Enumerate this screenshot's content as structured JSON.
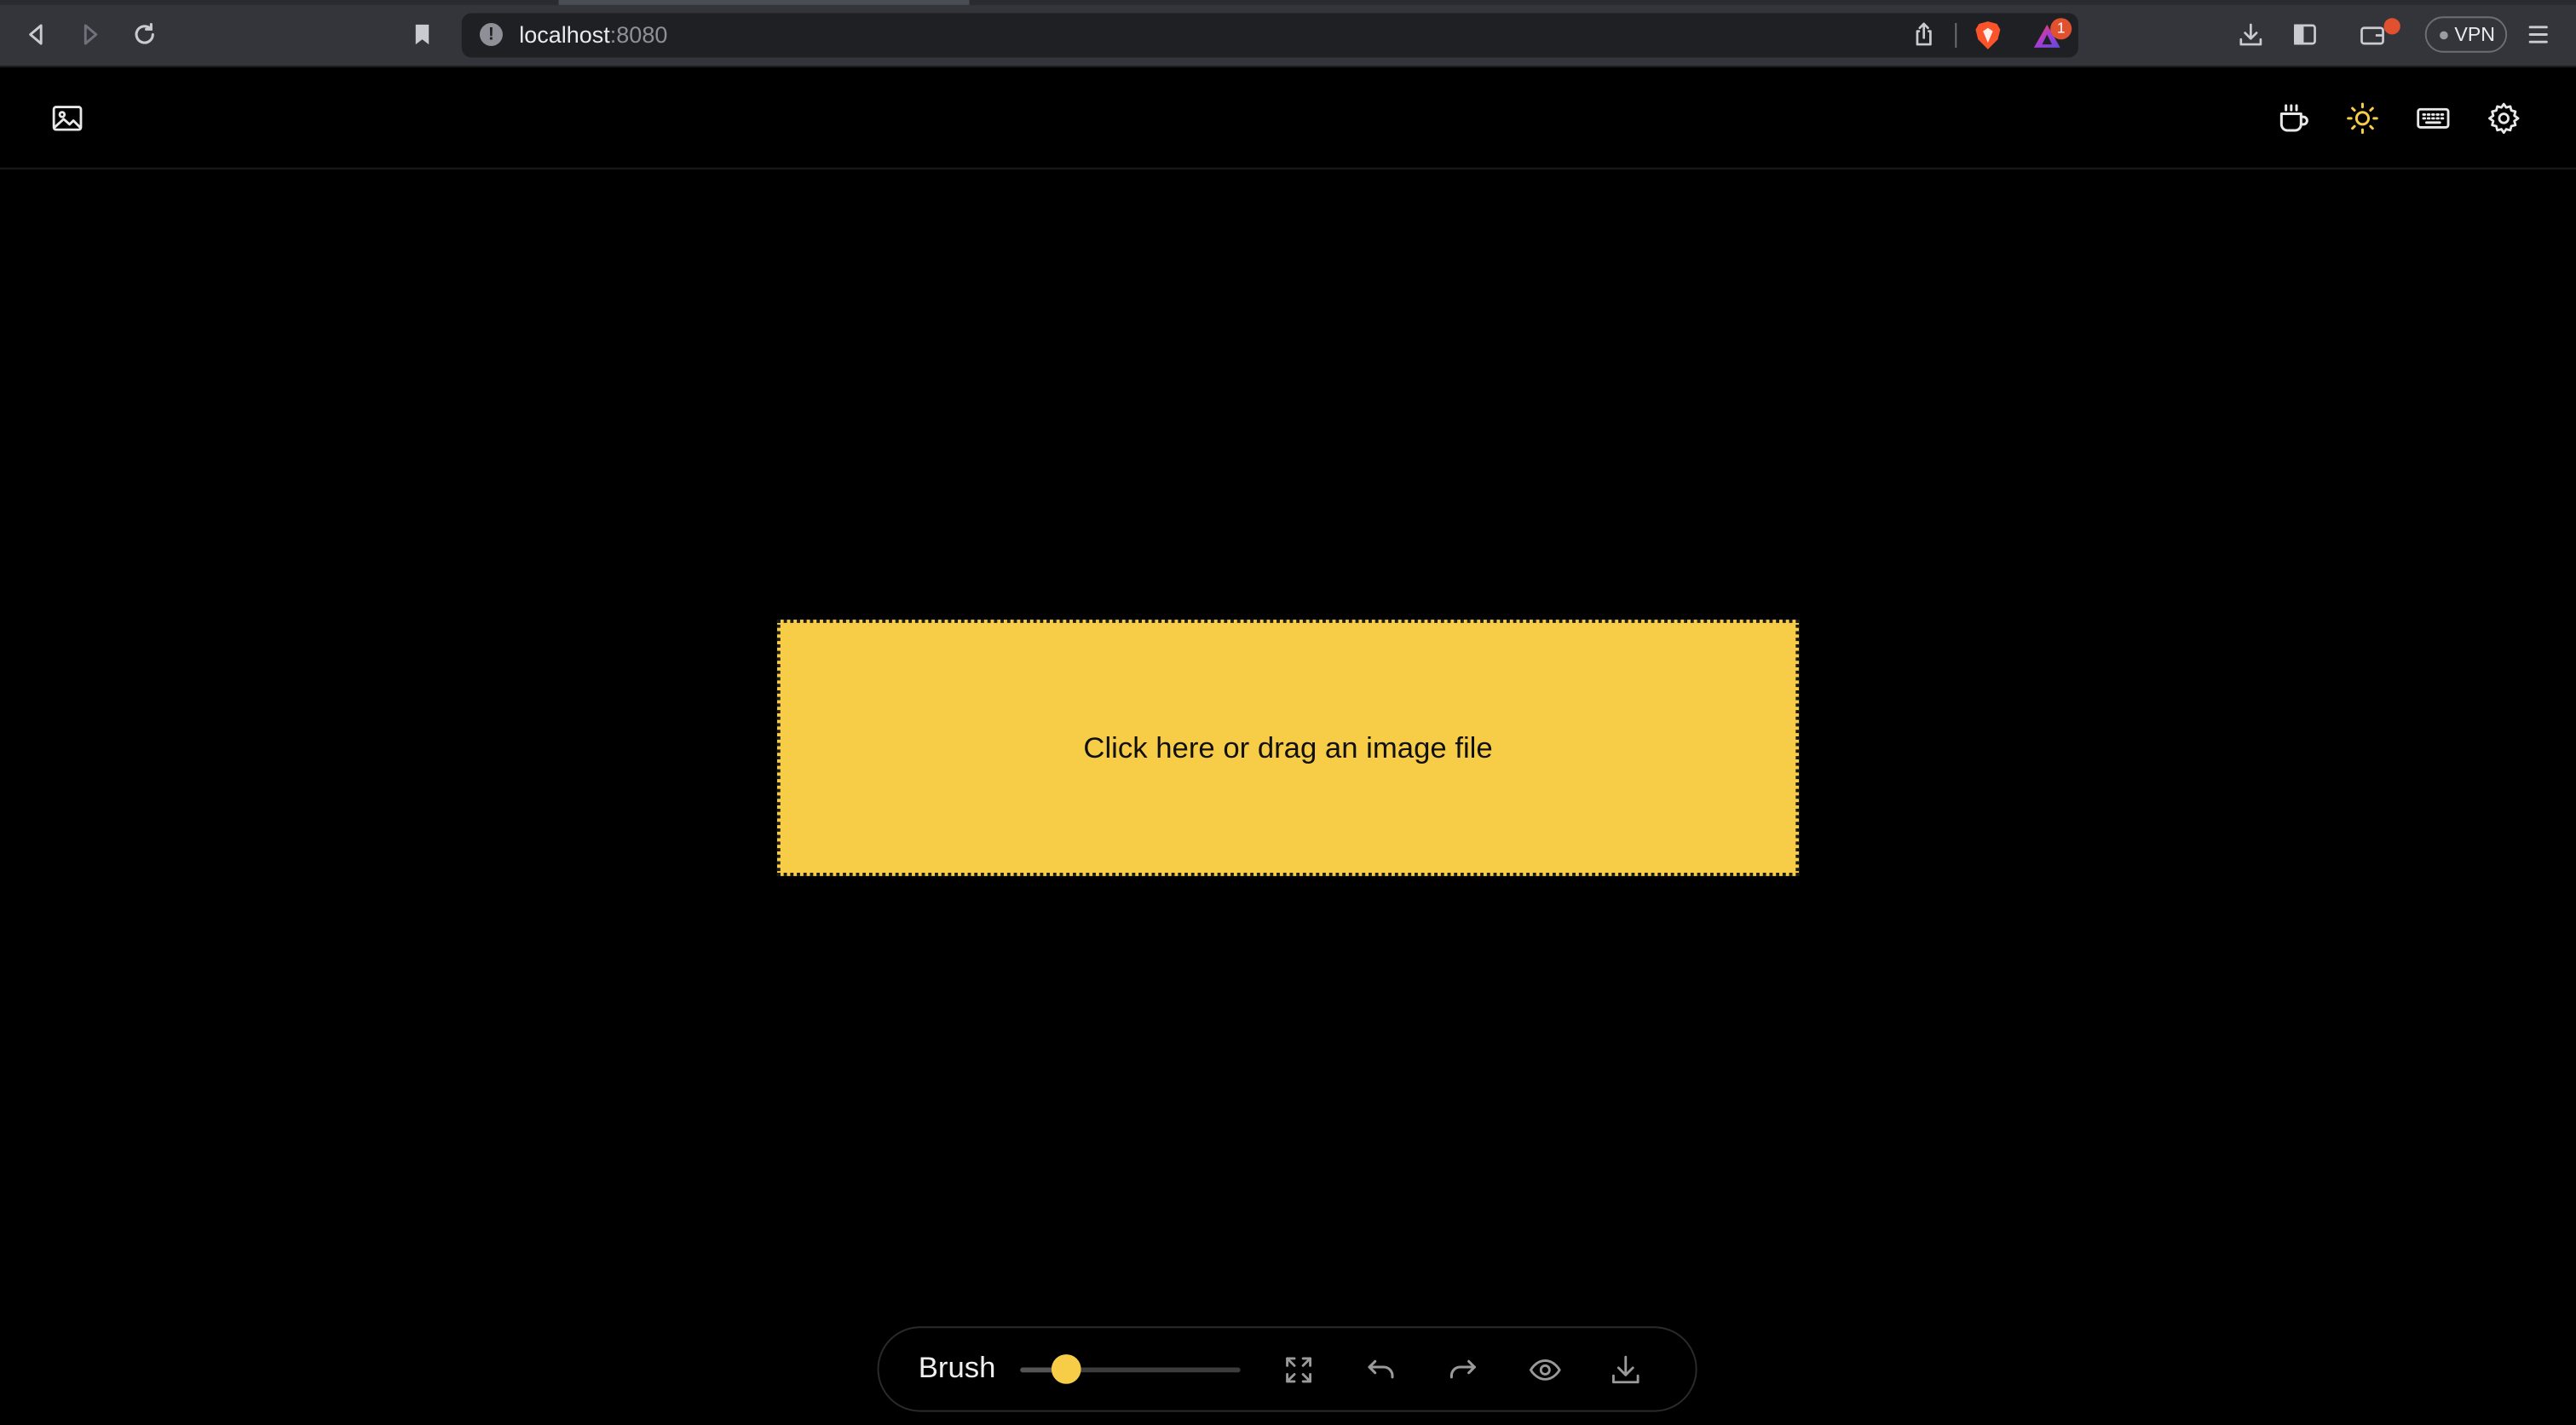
{
  "browser": {
    "url_host": "localhost",
    "url_port": ":8080",
    "rewards_badge": "1",
    "vpn_label": "VPN",
    "icons": [
      "back-icon",
      "forward-icon",
      "reload-icon",
      "bookmark-icon",
      "site-info-icon",
      "share-icon",
      "brave-shields-icon",
      "brave-rewards-icon",
      "downloads-icon",
      "sidebar-icon",
      "wallet-icon",
      "menu-icon"
    ]
  },
  "header": {
    "left_icons": [
      "image-icon"
    ],
    "right_icons": [
      "coffee-icon",
      "sun-icon",
      "keyboard-icon",
      "settings-icon"
    ]
  },
  "dropzone": {
    "text": "Click here or drag an image file"
  },
  "toolbar": {
    "brush_label": "Brush",
    "brush_size_fraction": 0.21,
    "icons": [
      "fullscreen-icon",
      "undo-icon",
      "redo-icon",
      "eye-icon",
      "download-icon"
    ]
  },
  "colors": {
    "accent": "#f7cd48",
    "background": "#000000",
    "chrome": "#34353b"
  }
}
